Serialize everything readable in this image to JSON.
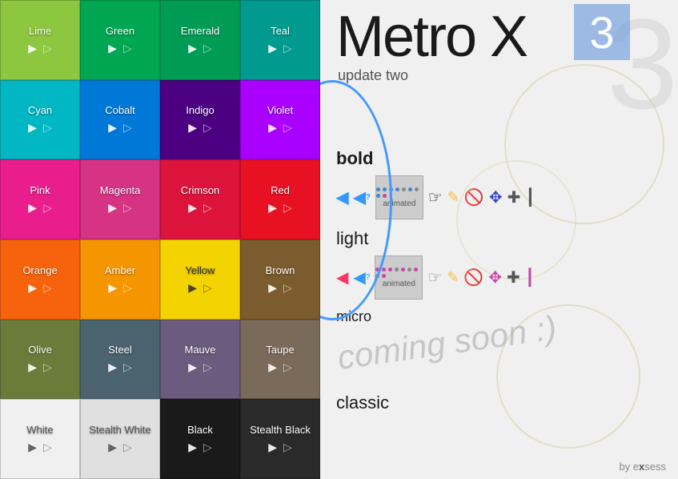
{
  "app": {
    "title": "Metro X",
    "subtitle": "update two",
    "version_number": "3"
  },
  "tiles": [
    {
      "label": "Lime",
      "class": "tile-lime",
      "row": 1
    },
    {
      "label": "Green",
      "class": "tile-green",
      "row": 1
    },
    {
      "label": "Emerald",
      "class": "tile-emerald",
      "row": 1
    },
    {
      "label": "Teal",
      "class": "tile-teal",
      "row": 1
    },
    {
      "label": "Cyan",
      "class": "tile-cyan",
      "row": 2
    },
    {
      "label": "Cobalt",
      "class": "tile-cobalt",
      "row": 2
    },
    {
      "label": "Indigo",
      "class": "tile-indigo",
      "row": 2
    },
    {
      "label": "Violet",
      "class": "tile-violet",
      "row": 2
    },
    {
      "label": "Pink",
      "class": "tile-pink",
      "row": 3
    },
    {
      "label": "Magenta",
      "class": "tile-magenta",
      "row": 3
    },
    {
      "label": "Crimson",
      "class": "tile-crimson",
      "row": 3
    },
    {
      "label": "Red",
      "class": "tile-red",
      "row": 3
    },
    {
      "label": "Orange",
      "class": "tile-orange",
      "row": 4
    },
    {
      "label": "Amber",
      "class": "tile-amber",
      "row": 4
    },
    {
      "label": "Yellow",
      "class": "tile-yellow",
      "row": 4
    },
    {
      "label": "Brown",
      "class": "tile-brown",
      "row": 4
    },
    {
      "label": "Olive",
      "class": "tile-olive",
      "row": 5
    },
    {
      "label": "Steel",
      "class": "tile-steel",
      "row": 5
    },
    {
      "label": "Mauve",
      "class": "tile-mauve",
      "row": 5
    },
    {
      "label": "Taupe",
      "class": "tile-taupe",
      "row": 5
    },
    {
      "label": "White",
      "class": "tile-white",
      "row": 6
    },
    {
      "label": "Stealth White",
      "class": "tile-stealth-white",
      "row": 6
    },
    {
      "label": "Black",
      "class": "tile-black",
      "row": 6
    },
    {
      "label": "Stealth Black",
      "class": "tile-stealth-black",
      "row": 6
    }
  ],
  "sections": {
    "bold_label": "bold",
    "light_label": "light",
    "micro_label": "micro",
    "classic_label": "classic",
    "animated_label": "animated",
    "coming_soon_text": "coming soon :)"
  },
  "byline": {
    "text_pre": "by e",
    "text_bold": "x",
    "text_post": "sess"
  },
  "cursors": {
    "bold_row": [
      "arrow",
      "question",
      "animated",
      "hand",
      "pencil",
      "no",
      "move",
      "cross",
      "beam"
    ],
    "light_row": [
      "arrow",
      "question",
      "animated",
      "hand",
      "pencil",
      "no",
      "move",
      "cross",
      "beam"
    ]
  }
}
